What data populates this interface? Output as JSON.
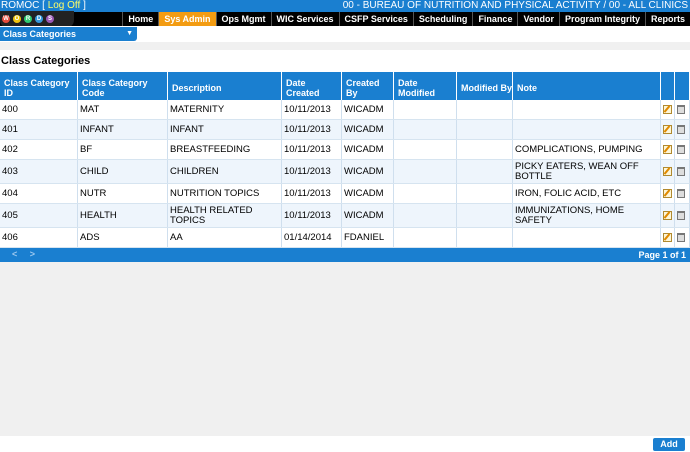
{
  "topbar": {
    "user": "ROMOC",
    "bracket_open": " [ ",
    "logoff": "Log Off",
    "bracket_close": " ]",
    "agency": "00 - BUREAU OF NUTRITION AND PHYSICAL ACTIVITY / 00 - ALL CLINICS"
  },
  "logo_letters": [
    "W",
    "O",
    "R",
    "D",
    "S"
  ],
  "logo_colors": [
    "#e74c3c",
    "#f1c40f",
    "#2ecc71",
    "#3498db",
    "#9b59b6"
  ],
  "nav": [
    {
      "label": "Home",
      "active": false
    },
    {
      "label": "Sys Admin",
      "active": true
    },
    {
      "label": "Ops Mgmt",
      "active": false
    },
    {
      "label": "WIC Services",
      "active": false
    },
    {
      "label": "CSFP Services",
      "active": false
    },
    {
      "label": "Scheduling",
      "active": false
    },
    {
      "label": "Finance",
      "active": false
    },
    {
      "label": "Vendor",
      "active": false
    },
    {
      "label": "Program Integrity",
      "active": false
    },
    {
      "label": "Reports",
      "active": false
    }
  ],
  "dropdown": {
    "label": "Class Categories"
  },
  "page_title": "Class Categories",
  "columns": [
    "Class Category ID",
    "Class Category Code",
    "Description",
    "Date Created",
    "Created By",
    "Date Modified",
    "Modified By",
    "Note"
  ],
  "rows": [
    {
      "id": "400",
      "code": "MAT",
      "desc": "MATERNITY",
      "created": "10/11/2013",
      "by": "WICADM",
      "mod": "",
      "modby": "",
      "note": ""
    },
    {
      "id": "401",
      "code": "INFANT",
      "desc": "INFANT",
      "created": "10/11/2013",
      "by": "WICADM",
      "mod": "",
      "modby": "",
      "note": ""
    },
    {
      "id": "402",
      "code": "BF",
      "desc": "BREASTFEEDING",
      "created": "10/11/2013",
      "by": "WICADM",
      "mod": "",
      "modby": "",
      "note": "COMPLICATIONS, PUMPING"
    },
    {
      "id": "403",
      "code": "CHILD",
      "desc": "CHILDREN",
      "created": "10/11/2013",
      "by": "WICADM",
      "mod": "",
      "modby": "",
      "note": "PICKY EATERS, WEAN OFF BOTTLE"
    },
    {
      "id": "404",
      "code": "NUTR",
      "desc": "NUTRITION TOPICS",
      "created": "10/11/2013",
      "by": "WICADM",
      "mod": "",
      "modby": "",
      "note": "IRON, FOLIC ACID, ETC"
    },
    {
      "id": "405",
      "code": "HEALTH",
      "desc": "HEALTH RELATED TOPICS",
      "created": "10/11/2013",
      "by": "WICADM",
      "mod": "",
      "modby": "",
      "note": "IMMUNIZATIONS, HOME SAFETY"
    },
    {
      "id": "406",
      "code": "ADS",
      "desc": "AA",
      "created": "01/14/2014",
      "by": "FDANIEL",
      "mod": "",
      "modby": "",
      "note": ""
    }
  ],
  "pager": {
    "prev": "<",
    "next": ">",
    "info": "Page 1 of 1"
  },
  "add_label": "Add"
}
